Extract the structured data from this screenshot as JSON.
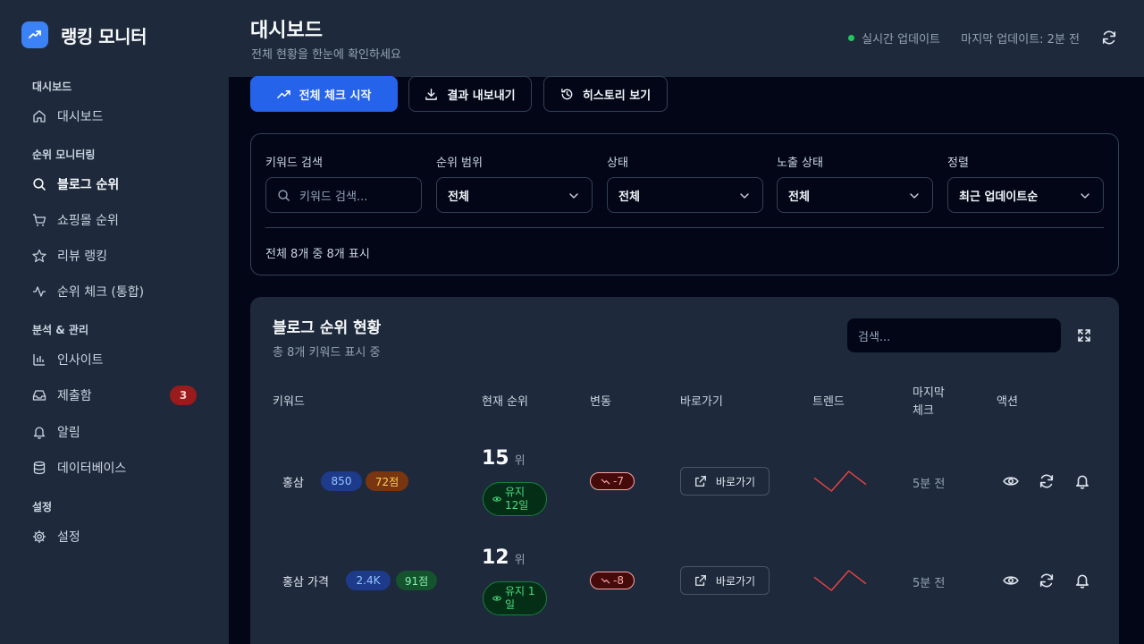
{
  "app": {
    "name": "랭킹 모니터"
  },
  "sidebar": {
    "sections": [
      {
        "label": "대시보드"
      },
      {
        "label": "순위 모니터링"
      },
      {
        "label": "분석 & 관리"
      },
      {
        "label": "설정"
      }
    ],
    "items": [
      {
        "label": "대시보드",
        "icon": "home-icon"
      },
      {
        "label": "블로그 순위",
        "icon": "search-icon",
        "active": true
      },
      {
        "label": "쇼핑몰 순위",
        "icon": "cart-icon"
      },
      {
        "label": "리뷰 랭킹",
        "icon": "star-icon"
      },
      {
        "label": "순위 체크 (통합)",
        "icon": "activity-icon"
      },
      {
        "label": "인사이트",
        "icon": "bar-chart-icon"
      },
      {
        "label": "제출함",
        "icon": "inbox-icon",
        "badge": "3"
      },
      {
        "label": "알림",
        "icon": "bell-icon"
      },
      {
        "label": "데이터베이스",
        "icon": "database-icon"
      },
      {
        "label": "설정",
        "icon": "gear-icon"
      }
    ]
  },
  "header": {
    "title": "대시보드",
    "subtitle": "전체 현황을 한눈에 확인하세요",
    "live_status": "실시간 업데이트",
    "last_update": "마지막 업데이트: 2분 전"
  },
  "actions": {
    "start_check": "전체 체크 시작",
    "export": "결과 내보내기",
    "history": "히스토리 보기"
  },
  "filters": {
    "keyword_label": "키워드 검색",
    "keyword_placeholder": "키워드 검색...",
    "range_label": "순위 범위",
    "range_value": "전체",
    "status_label": "상태",
    "status_value": "전체",
    "exposure_label": "노출 상태",
    "exposure_value": "전체",
    "sort_label": "정렬",
    "sort_value": "최근 업데이트순",
    "count_text": "전체 8개 중 8개 표시"
  },
  "table": {
    "title": "블로그 순위 현황",
    "subtitle": "총 8개 키워드 표시 중",
    "search_placeholder": "검색...",
    "headers": {
      "keyword": "키워드",
      "rank": "현재 순위",
      "change": "변동",
      "link": "바로가기",
      "trend": "트렌드",
      "last_check_1": "마지막",
      "last_check_2": "체크",
      "action": "액션"
    },
    "rows": [
      {
        "keyword": "홍삼",
        "volume": "850",
        "score": "72점",
        "score_color": "amber",
        "rank": "15",
        "rank_unit": "위",
        "keep_1": "유지",
        "keep_2": "12일",
        "change": "-7",
        "link_label": "바로가기",
        "trend": [
          2,
          0,
          3,
          1
        ],
        "ago": "5분 전"
      },
      {
        "keyword": "홍삼 가격",
        "volume": "2.4K",
        "score": "91점",
        "score_color": "green",
        "rank": "12",
        "rank_unit": "위",
        "keep_1": "유지 1",
        "keep_2": "일",
        "change": "-8",
        "link_label": "바로가기",
        "trend": [
          2,
          0,
          3,
          1
        ],
        "ago": "5분 전"
      }
    ]
  },
  "colors": {
    "accent": "#2563eb",
    "positive": "#22c55e",
    "negative": "#ef4444"
  }
}
